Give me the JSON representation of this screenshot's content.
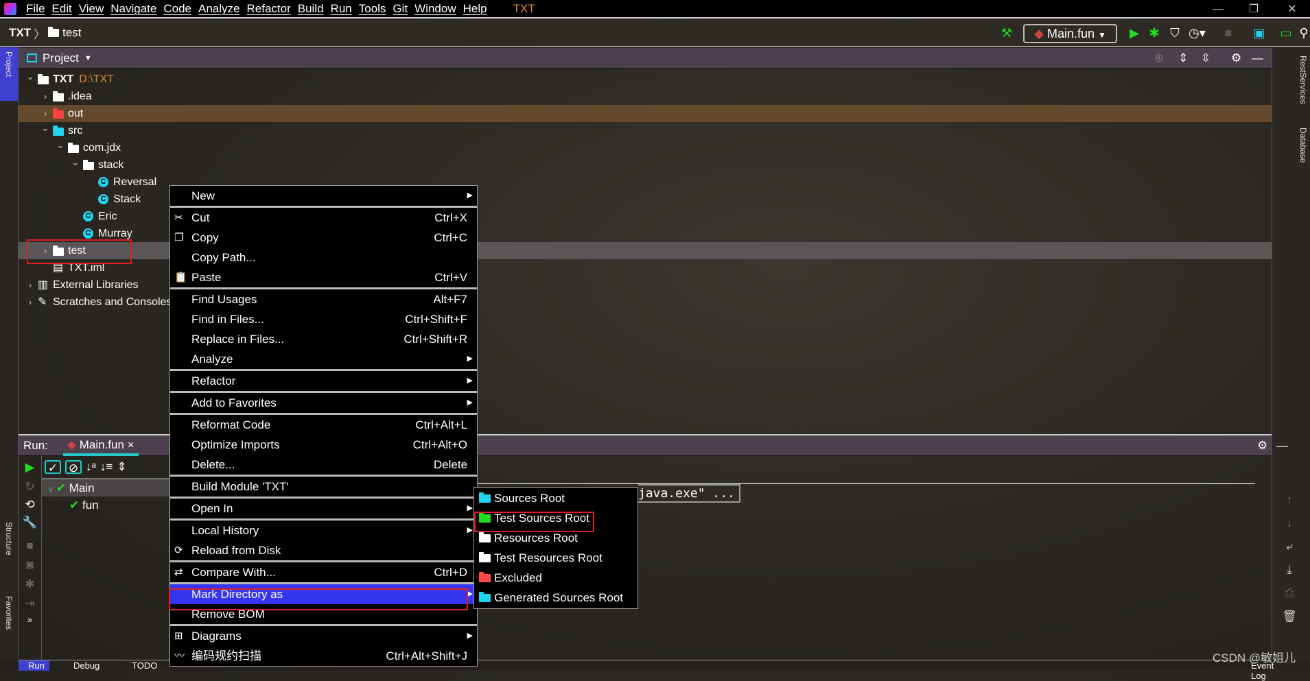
{
  "menubar": {
    "items": [
      "File",
      "Edit",
      "View",
      "Navigate",
      "Code",
      "Analyze",
      "Refactor",
      "Build",
      "Run",
      "Tools",
      "Git",
      "Window",
      "Help"
    ],
    "project": "TXT"
  },
  "navbar": {
    "project": "TXT",
    "folder": "test"
  },
  "toolbar": {
    "run_config": "Main.fun"
  },
  "project_panel": {
    "title": "Project",
    "tree": [
      {
        "label": "TXT",
        "extra": "D:\\TXT",
        "depth": 0,
        "arrow": "v",
        "icon": "folder",
        "color": "#ffffff",
        "bold": true
      },
      {
        "label": ".idea",
        "depth": 1,
        "arrow": ">",
        "icon": "folder",
        "color": "#ffffff"
      },
      {
        "label": "out",
        "depth": 1,
        "arrow": ">",
        "icon": "folder",
        "color": "#ff4040"
      },
      {
        "label": "src",
        "depth": 1,
        "arrow": "v",
        "icon": "folder",
        "color": "#21d4f0"
      },
      {
        "label": "com.jdx",
        "depth": 2,
        "arrow": "v",
        "icon": "package",
        "color": "#ffffff"
      },
      {
        "label": "stack",
        "depth": 3,
        "arrow": "v",
        "icon": "package",
        "color": "#ffffff"
      },
      {
        "label": "Reversal",
        "depth": 4,
        "icon": "class"
      },
      {
        "label": "Stack",
        "depth": 4,
        "icon": "class"
      },
      {
        "label": "Eric",
        "depth": 3,
        "icon": "class"
      },
      {
        "label": "Murray",
        "depth": 3,
        "icon": "class"
      },
      {
        "label": "test",
        "depth": 1,
        "arrow": ">",
        "icon": "folder",
        "color": "#ffffff",
        "selected": true
      },
      {
        "label": "TXT.iml",
        "depth": 1,
        "icon": "file"
      },
      {
        "label": "External Libraries",
        "depth": 0,
        "arrow": ">",
        "icon": "library"
      },
      {
        "label": "Scratches and Consoles",
        "depth": 0,
        "arrow": ">",
        "icon": "scratch"
      }
    ]
  },
  "side_tabs": {
    "project": "Project",
    "structure": "Structure",
    "favorites": "Favorites",
    "rest": "RestServices",
    "database": "Database"
  },
  "run_panel": {
    "label": "Run:",
    "tab": "Main.fun",
    "tree": [
      {
        "label": "Main"
      },
      {
        "label": "fun"
      }
    ],
    "console": "java.exe\" ..."
  },
  "bottom_tabs": [
    "Run",
    "Debug",
    "TODO"
  ],
  "event_log": "Event Log",
  "watermark": "CSDN @敏姐儿",
  "context_menu": [
    {
      "label": "New",
      "submenu": true
    },
    "sep",
    {
      "label": "Cut",
      "shortcut": "Ctrl+X",
      "icon": "✂"
    },
    {
      "label": "Copy",
      "shortcut": "Ctrl+C",
      "icon": "❐"
    },
    {
      "label": "Copy Path..."
    },
    {
      "label": "Paste",
      "shortcut": "Ctrl+V",
      "icon": "📋"
    },
    "sep",
    {
      "label": "Find Usages",
      "shortcut": "Alt+F7"
    },
    {
      "label": "Find in Files...",
      "shortcut": "Ctrl+Shift+F"
    },
    {
      "label": "Replace in Files...",
      "shortcut": "Ctrl+Shift+R"
    },
    {
      "label": "Analyze",
      "submenu": true
    },
    "sep",
    {
      "label": "Refactor",
      "submenu": true
    },
    "sep",
    {
      "label": "Add to Favorites",
      "submenu": true
    },
    "sep",
    {
      "label": "Reformat Code",
      "shortcut": "Ctrl+Alt+L"
    },
    {
      "label": "Optimize Imports",
      "shortcut": "Ctrl+Alt+O"
    },
    {
      "label": "Delete...",
      "shortcut": "Delete"
    },
    "sep",
    {
      "label": "Build Module 'TXT'"
    },
    "sep",
    {
      "label": "Open In",
      "submenu": true
    },
    "sep",
    {
      "label": "Local History",
      "submenu": true
    },
    {
      "label": "Reload from Disk",
      "icon": "⟳"
    },
    "sep",
    {
      "label": "Compare With...",
      "shortcut": "Ctrl+D",
      "icon": "⇄"
    },
    "sep",
    {
      "label": "Mark Directory as",
      "submenu": true,
      "highlighted": true
    },
    {
      "label": "Remove BOM"
    },
    "sep",
    {
      "label": "Diagrams",
      "submenu": true,
      "icon": "⊞"
    },
    {
      "label": "编码规约扫描",
      "shortcut": "Ctrl+Alt+Shift+J",
      "icon": "〰"
    }
  ],
  "submenu": [
    {
      "label": "Sources Root",
      "color": "#21d4f0"
    },
    {
      "label": "Test Sources Root",
      "color": "#22dd22"
    },
    {
      "label": "Resources Root",
      "color": "#ffffff"
    },
    {
      "label": "Test Resources Root",
      "color": "#ffffff"
    },
    {
      "label": "Excluded",
      "color": "#ff4848"
    },
    {
      "label": "Generated Sources Root",
      "color": "#21d4f0"
    }
  ],
  "colors": {
    "accent_highlight": "#3535f0",
    "annotation_box": "#e02020",
    "run_green": "#22dd22"
  }
}
